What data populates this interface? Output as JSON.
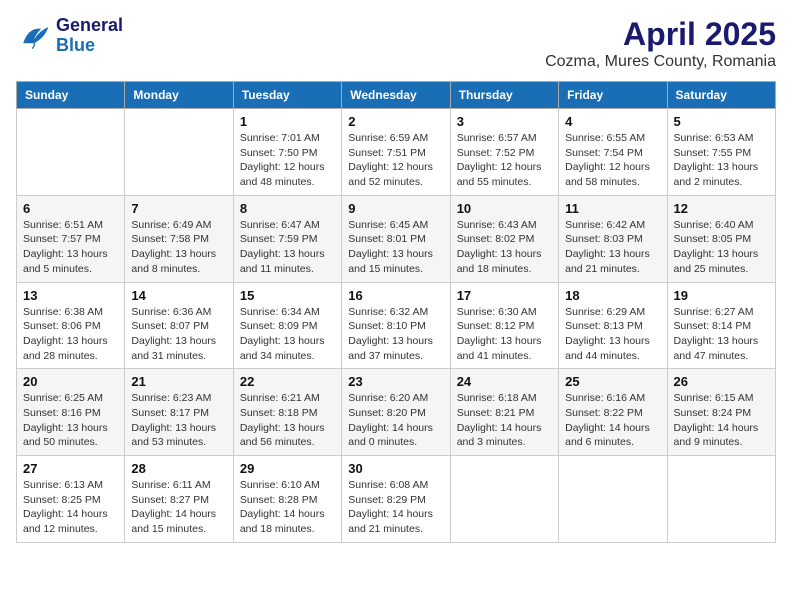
{
  "header": {
    "logo_general": "General",
    "logo_blue": "Blue",
    "title": "April 2025",
    "subtitle": "Cozma, Mures County, Romania"
  },
  "days_of_week": [
    "Sunday",
    "Monday",
    "Tuesday",
    "Wednesday",
    "Thursday",
    "Friday",
    "Saturday"
  ],
  "weeks": [
    [
      {
        "day": "",
        "info": ""
      },
      {
        "day": "",
        "info": ""
      },
      {
        "day": "1",
        "info": "Sunrise: 7:01 AM\nSunset: 7:50 PM\nDaylight: 12 hours\nand 48 minutes."
      },
      {
        "day": "2",
        "info": "Sunrise: 6:59 AM\nSunset: 7:51 PM\nDaylight: 12 hours\nand 52 minutes."
      },
      {
        "day": "3",
        "info": "Sunrise: 6:57 AM\nSunset: 7:52 PM\nDaylight: 12 hours\nand 55 minutes."
      },
      {
        "day": "4",
        "info": "Sunrise: 6:55 AM\nSunset: 7:54 PM\nDaylight: 12 hours\nand 58 minutes."
      },
      {
        "day": "5",
        "info": "Sunrise: 6:53 AM\nSunset: 7:55 PM\nDaylight: 13 hours\nand 2 minutes."
      }
    ],
    [
      {
        "day": "6",
        "info": "Sunrise: 6:51 AM\nSunset: 7:57 PM\nDaylight: 13 hours\nand 5 minutes."
      },
      {
        "day": "7",
        "info": "Sunrise: 6:49 AM\nSunset: 7:58 PM\nDaylight: 13 hours\nand 8 minutes."
      },
      {
        "day": "8",
        "info": "Sunrise: 6:47 AM\nSunset: 7:59 PM\nDaylight: 13 hours\nand 11 minutes."
      },
      {
        "day": "9",
        "info": "Sunrise: 6:45 AM\nSunset: 8:01 PM\nDaylight: 13 hours\nand 15 minutes."
      },
      {
        "day": "10",
        "info": "Sunrise: 6:43 AM\nSunset: 8:02 PM\nDaylight: 13 hours\nand 18 minutes."
      },
      {
        "day": "11",
        "info": "Sunrise: 6:42 AM\nSunset: 8:03 PM\nDaylight: 13 hours\nand 21 minutes."
      },
      {
        "day": "12",
        "info": "Sunrise: 6:40 AM\nSunset: 8:05 PM\nDaylight: 13 hours\nand 25 minutes."
      }
    ],
    [
      {
        "day": "13",
        "info": "Sunrise: 6:38 AM\nSunset: 8:06 PM\nDaylight: 13 hours\nand 28 minutes."
      },
      {
        "day": "14",
        "info": "Sunrise: 6:36 AM\nSunset: 8:07 PM\nDaylight: 13 hours\nand 31 minutes."
      },
      {
        "day": "15",
        "info": "Sunrise: 6:34 AM\nSunset: 8:09 PM\nDaylight: 13 hours\nand 34 minutes."
      },
      {
        "day": "16",
        "info": "Sunrise: 6:32 AM\nSunset: 8:10 PM\nDaylight: 13 hours\nand 37 minutes."
      },
      {
        "day": "17",
        "info": "Sunrise: 6:30 AM\nSunset: 8:12 PM\nDaylight: 13 hours\nand 41 minutes."
      },
      {
        "day": "18",
        "info": "Sunrise: 6:29 AM\nSunset: 8:13 PM\nDaylight: 13 hours\nand 44 minutes."
      },
      {
        "day": "19",
        "info": "Sunrise: 6:27 AM\nSunset: 8:14 PM\nDaylight: 13 hours\nand 47 minutes."
      }
    ],
    [
      {
        "day": "20",
        "info": "Sunrise: 6:25 AM\nSunset: 8:16 PM\nDaylight: 13 hours\nand 50 minutes."
      },
      {
        "day": "21",
        "info": "Sunrise: 6:23 AM\nSunset: 8:17 PM\nDaylight: 13 hours\nand 53 minutes."
      },
      {
        "day": "22",
        "info": "Sunrise: 6:21 AM\nSunset: 8:18 PM\nDaylight: 13 hours\nand 56 minutes."
      },
      {
        "day": "23",
        "info": "Sunrise: 6:20 AM\nSunset: 8:20 PM\nDaylight: 14 hours\nand 0 minutes."
      },
      {
        "day": "24",
        "info": "Sunrise: 6:18 AM\nSunset: 8:21 PM\nDaylight: 14 hours\nand 3 minutes."
      },
      {
        "day": "25",
        "info": "Sunrise: 6:16 AM\nSunset: 8:22 PM\nDaylight: 14 hours\nand 6 minutes."
      },
      {
        "day": "26",
        "info": "Sunrise: 6:15 AM\nSunset: 8:24 PM\nDaylight: 14 hours\nand 9 minutes."
      }
    ],
    [
      {
        "day": "27",
        "info": "Sunrise: 6:13 AM\nSunset: 8:25 PM\nDaylight: 14 hours\nand 12 minutes."
      },
      {
        "day": "28",
        "info": "Sunrise: 6:11 AM\nSunset: 8:27 PM\nDaylight: 14 hours\nand 15 minutes."
      },
      {
        "day": "29",
        "info": "Sunrise: 6:10 AM\nSunset: 8:28 PM\nDaylight: 14 hours\nand 18 minutes."
      },
      {
        "day": "30",
        "info": "Sunrise: 6:08 AM\nSunset: 8:29 PM\nDaylight: 14 hours\nand 21 minutes."
      },
      {
        "day": "",
        "info": ""
      },
      {
        "day": "",
        "info": ""
      },
      {
        "day": "",
        "info": ""
      }
    ]
  ]
}
